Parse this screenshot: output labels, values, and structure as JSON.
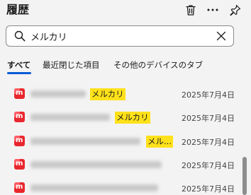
{
  "header": {
    "title": "履歴",
    "icons": [
      "trash-icon",
      "more-icon",
      "pin-icon"
    ]
  },
  "search": {
    "value": "メルカリ",
    "placeholder": "",
    "icon": "search-icon",
    "clear_icon": "close-icon"
  },
  "tabs": [
    {
      "label": "すべて",
      "active": true
    },
    {
      "label": "最近閉じた項目",
      "active": false
    },
    {
      "label": "その他のデバイスのタブ",
      "active": false
    }
  ],
  "colors": {
    "accent": "#0a5bd6",
    "highlight": "#ffe11a",
    "favicon": "#e9262d"
  },
  "history": [
    {
      "favicon": "mercari-icon",
      "match": "メルカリ",
      "date": "2025年7月4日"
    },
    {
      "favicon": "mercari-icon",
      "match": "メルカリ",
      "date": "2025年7月4日"
    },
    {
      "favicon": "mercari-icon",
      "match": "メル...",
      "date": "2025年7月4日"
    },
    {
      "favicon": "mercari-icon",
      "match": "",
      "date": "2025年7月4日"
    },
    {
      "favicon": "mercari-icon",
      "match": "",
      "date": "2025年7月4日"
    }
  ]
}
